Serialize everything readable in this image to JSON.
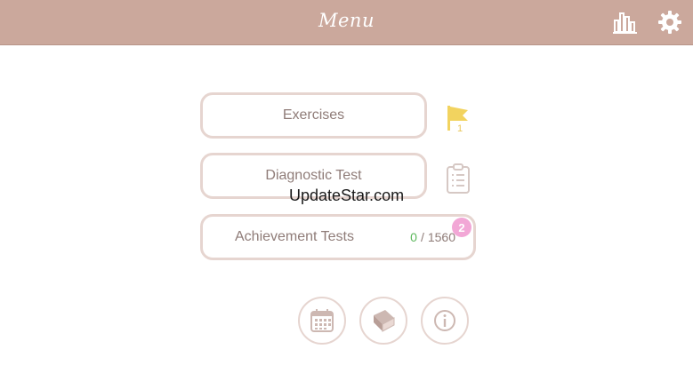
{
  "header": {
    "title": "Menu",
    "stats_icon": "bar-chart-icon",
    "settings_icon": "gear-icon",
    "background_color": "#cba89c"
  },
  "menu": {
    "exercises": {
      "label": "Exercises",
      "flag_count": "1"
    },
    "diagnostic": {
      "label": "Diagnostic Test"
    },
    "achievement": {
      "label": "Achievement Tests",
      "completed": "0",
      "separator": "/",
      "total": "1560",
      "badge": "2"
    }
  },
  "watermark": "UpdateStar.com",
  "bottom_buttons": [
    {
      "icon": "calendar-icon"
    },
    {
      "icon": "book-icon"
    },
    {
      "icon": "info-icon"
    }
  ],
  "colors": {
    "accent": "#cba89c",
    "button_border": "#e6d5d0",
    "label_text": "#8f7c78",
    "progress_done": "#5cb85c",
    "badge": "#f2a7d6",
    "flag": "#f2d35f"
  }
}
